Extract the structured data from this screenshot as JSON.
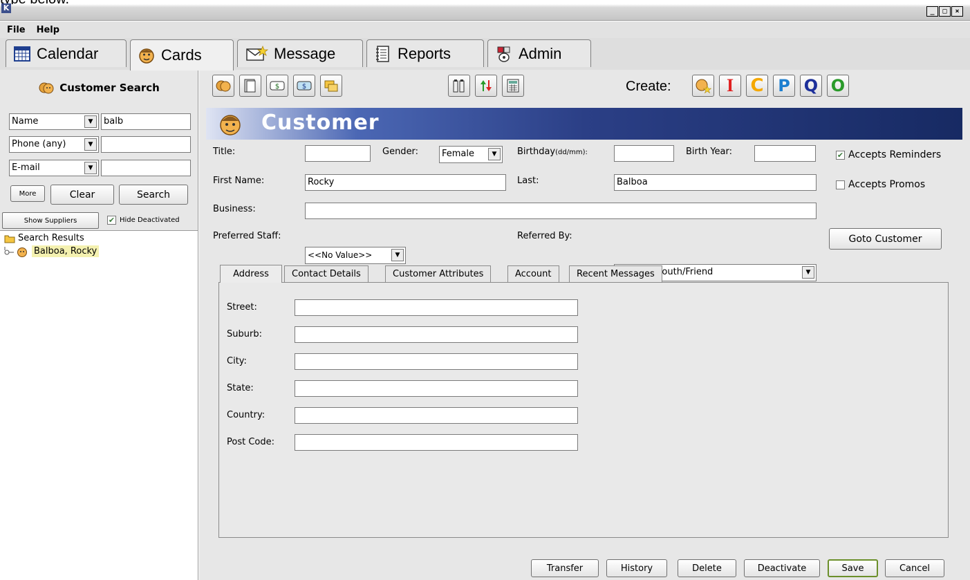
{
  "overflow_text": "type below.",
  "window": {
    "app_letter": "K",
    "minimize": "_",
    "maximize": "□",
    "close": "×"
  },
  "menu": [
    "File",
    "Help"
  ],
  "main_tabs": [
    {
      "label": "Calendar",
      "icon": "calendar-icon"
    },
    {
      "label": "Cards",
      "icon": "face-icon"
    },
    {
      "label": "Message",
      "icon": "envelope-star-icon"
    },
    {
      "label": "Reports",
      "icon": "notepad-icon"
    },
    {
      "label": "Admin",
      "icon": "admin-icon"
    }
  ],
  "search": {
    "title": "Customer Search",
    "name_field": {
      "type": "Name",
      "value": "balb"
    },
    "phone_field": {
      "type": "Phone (any)",
      "value": ""
    },
    "email_field": {
      "type": "E-mail",
      "value": ""
    },
    "more": "More",
    "clear": "Clear",
    "search": "Search",
    "show_suppliers": "Show Suppliers",
    "hide_deactivated": "Hide Deactivated"
  },
  "tree": {
    "root": "Search Results",
    "items": [
      "Balboa, Rocky"
    ]
  },
  "toolbar": {
    "create_label": "Create:",
    "create_letters": [
      "I",
      "C",
      "P",
      "Q",
      "O"
    ]
  },
  "customer": {
    "banner": "Customer",
    "labels": {
      "title": "Title:",
      "gender": "Gender:",
      "birthday": "Birthday",
      "birthday_fmt": "(dd/mm):",
      "birth_year": "Birth Year:",
      "first": "First Name:",
      "last": "Last:",
      "business": "Business:",
      "staff": "Preferred Staff:",
      "referred": "Referred By:",
      "accepts_reminders": "Accepts Reminders",
      "accepts_promos": "Accepts Promos",
      "goto": "Goto Customer"
    },
    "values": {
      "title": "",
      "gender": "Female",
      "birthday": "",
      "birth_year": "",
      "first": "Rocky",
      "last": "Balboa",
      "business": "",
      "staff": "<<No Value>>",
      "referred": "Word of Mouth/Friend"
    },
    "tabs": [
      "Address",
      "Contact Details",
      "Customer Attributes",
      "Account",
      "Recent Messages"
    ],
    "address_labels": [
      "Street:",
      "Suburb:",
      "City:",
      "State:",
      "Country:",
      "Post Code:"
    ],
    "buttons": [
      "Transfer",
      "History",
      "Delete",
      "Deactivate",
      "Save",
      "Cancel"
    ]
  }
}
